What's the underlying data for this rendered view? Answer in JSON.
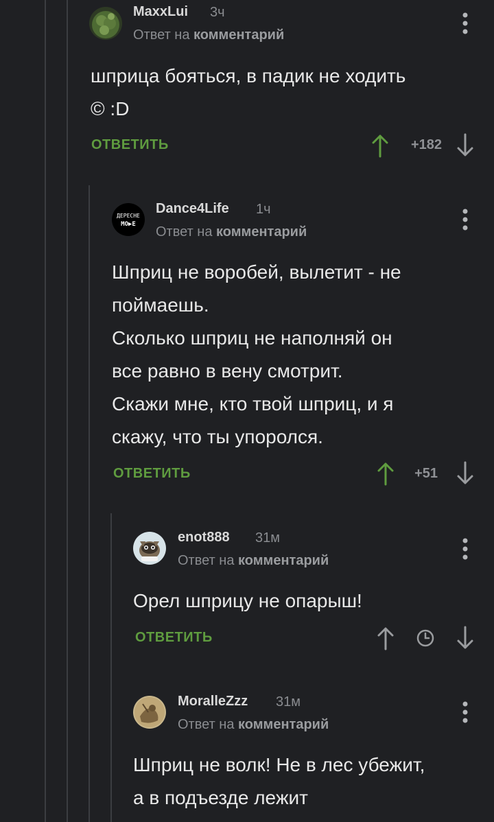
{
  "reply_to_prefix": "Ответ на ",
  "reply_to_link": "комментарий",
  "reply_label": "ОТВЕТИТЬ",
  "colors": {
    "background": "#1f2023",
    "accent_green": "#5f9c3f",
    "muted_text": "#8a8c90",
    "thread_line": "#3b3d41"
  },
  "comments": [
    {
      "author": "MaxxLui",
      "time": "3ч",
      "avatar_icon": "cannabis-avatar-icon",
      "text": "шприца бояться, в падик не ходить\n© :D",
      "score": "+182",
      "upvoted": true
    },
    {
      "author": "Dance4Life",
      "time": "1ч",
      "avatar_icon": "depeche-mode-logo-avatar",
      "avatar_text_line1": "ДЕРЕСНЕ",
      "avatar_text_line2": "MO▶E",
      "text": "Шприц не воробей, вылетит - не\nпоймаешь.\nСколько шприц не наполняй он\nвсе равно в вену смотрит.\nСкажи мне, кто твой шприц, и я\nскажу, что ты упоролся.",
      "score": "+51",
      "upvoted": true
    },
    {
      "author": "enot888",
      "time": "31м",
      "avatar_icon": "raccoon-avatar-icon",
      "text": "Орел шприцу не опарыш!",
      "score": "",
      "upvoted": false
    },
    {
      "author": "MoralleZzz",
      "time": "31м",
      "avatar_icon": "sepia-avatar-icon",
      "text": "Шприц не волк! Не в лес убежит,\nа в подъезде лежит",
      "score": "",
      "upvoted": false
    }
  ]
}
